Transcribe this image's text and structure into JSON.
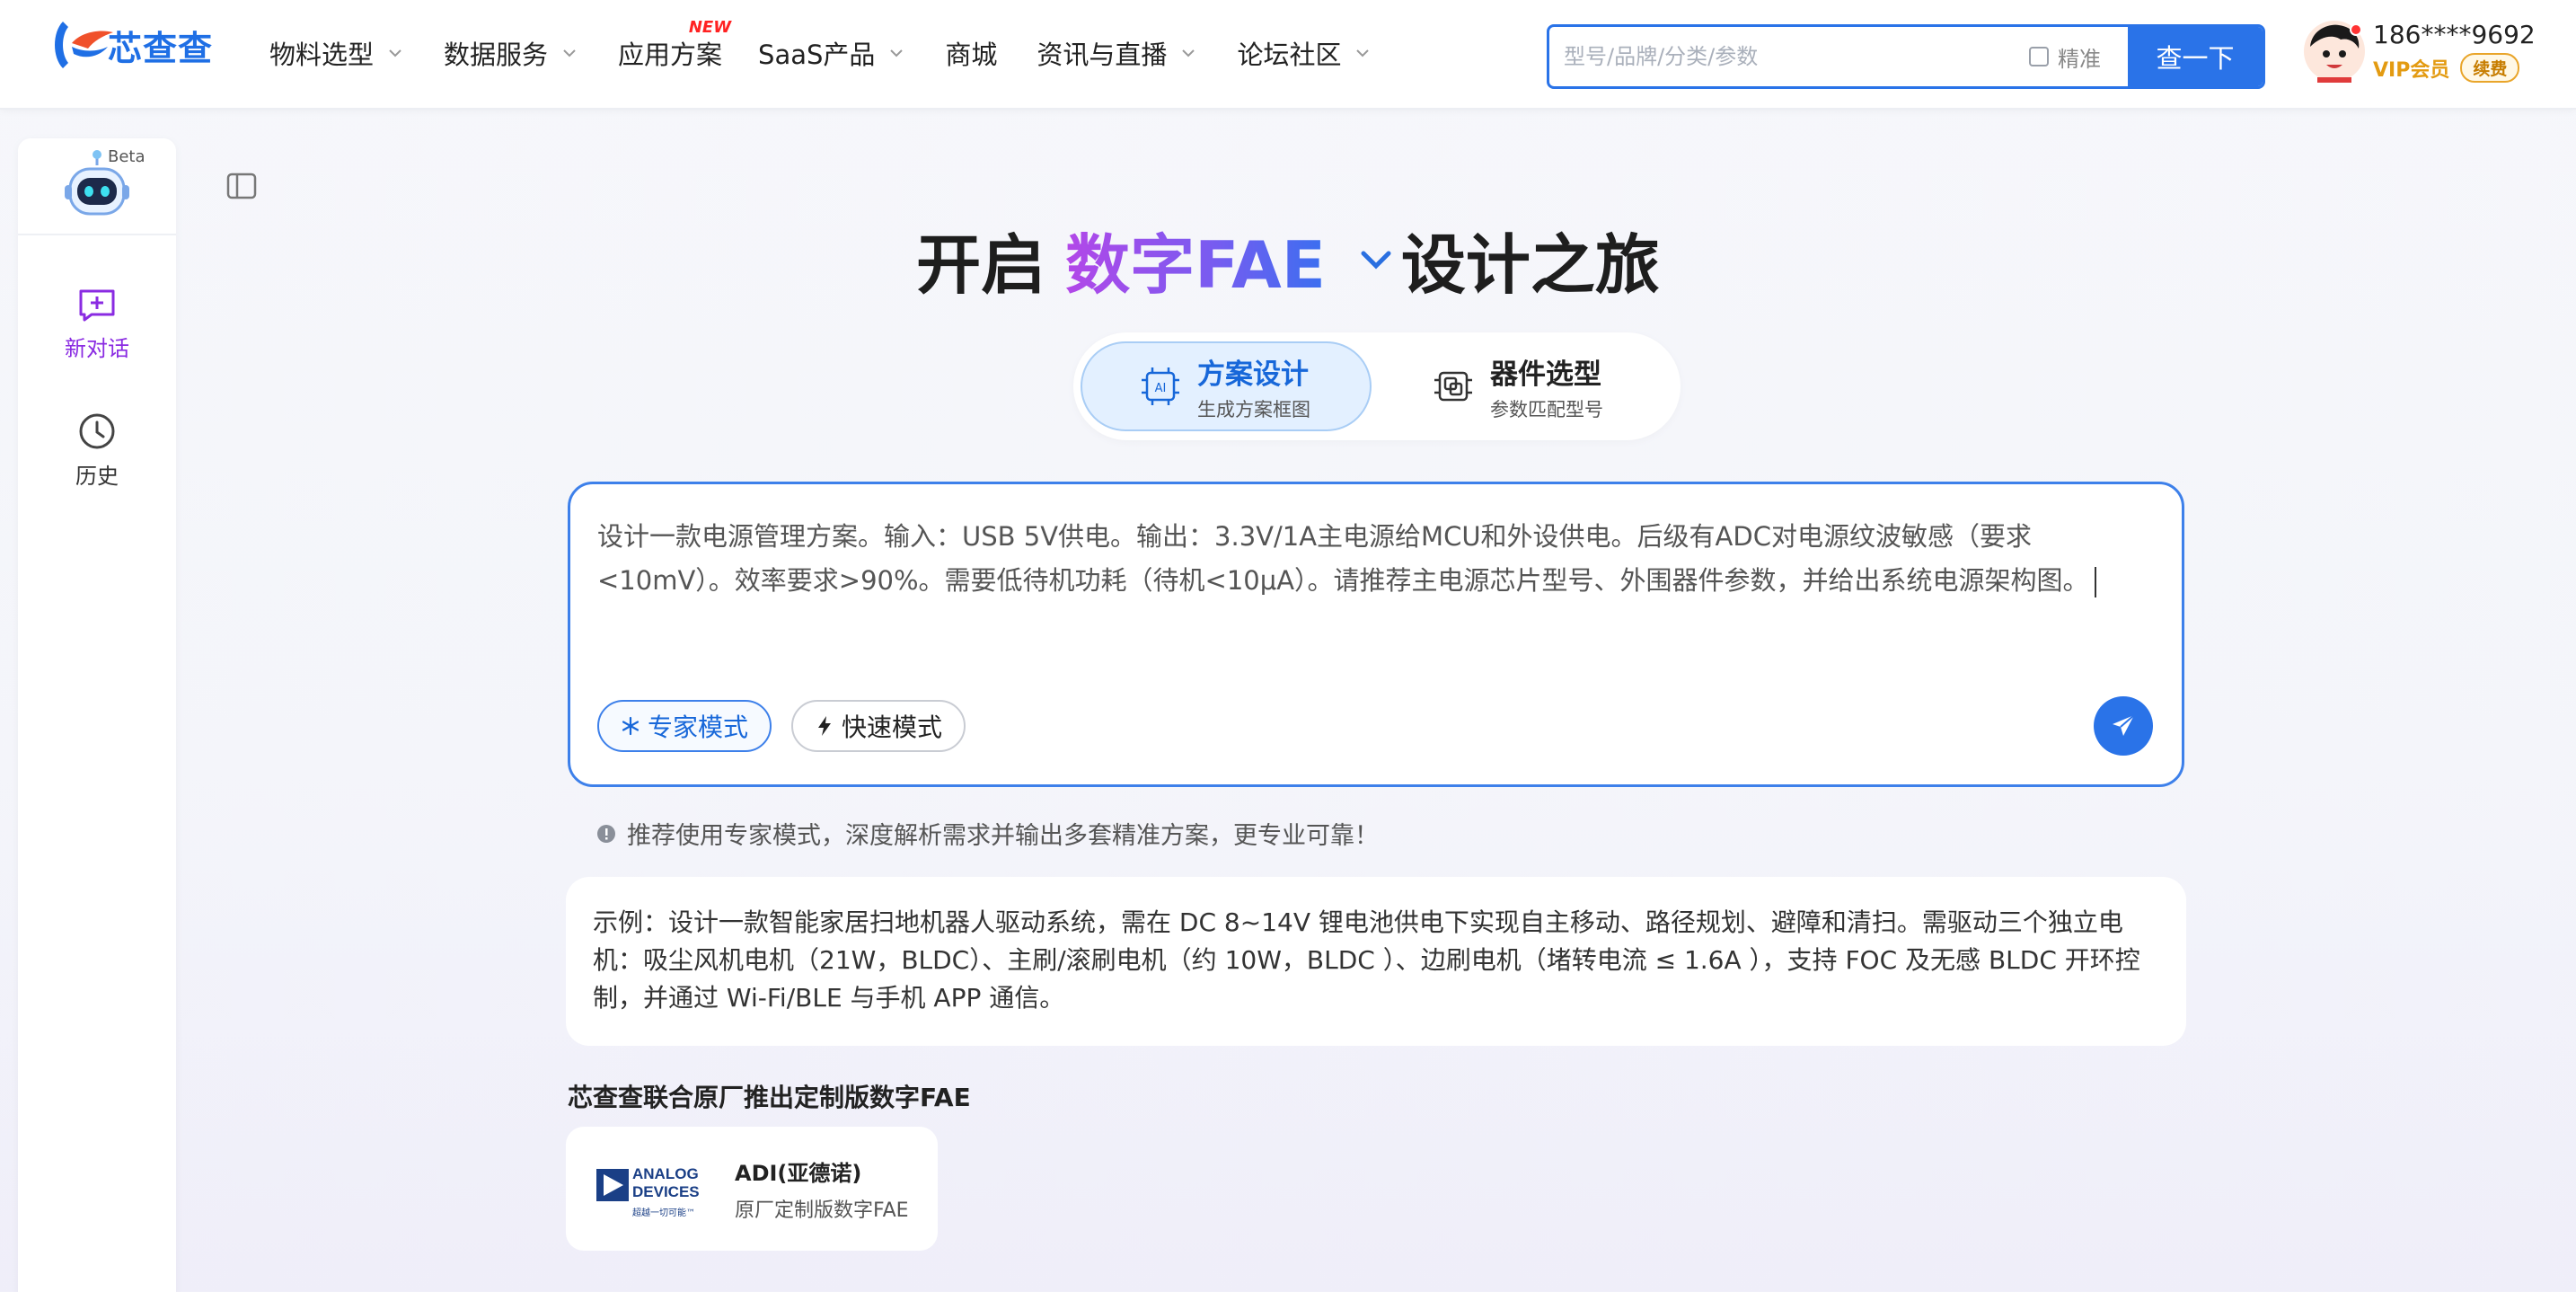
{
  "brand": {
    "name": "芯查查"
  },
  "nav": {
    "items": [
      {
        "label": "物料选型",
        "dropdown": true
      },
      {
        "label": "数据服务",
        "dropdown": true
      },
      {
        "label": "应用方案",
        "badge": "NEW"
      },
      {
        "label": "SaaS产品",
        "dropdown": true
      },
      {
        "label": "商城"
      },
      {
        "label": "资讯与直播",
        "dropdown": true
      },
      {
        "label": "论坛社区",
        "dropdown": true
      }
    ]
  },
  "search": {
    "placeholder": "型号/品牌/分类/参数",
    "precise_label": "精准",
    "button_label": "查一下"
  },
  "user": {
    "phone": "186****9692",
    "vip_label": "VIP会员",
    "renew_label": "续费"
  },
  "sidebar": {
    "beta": "Beta",
    "new_chat": "新对话",
    "history": "历史"
  },
  "hero": {
    "prefix": "开启",
    "highlight": "数字FAE",
    "suffix": "设计之旅"
  },
  "modes": {
    "scheme": {
      "title": "方案设计",
      "subtitle": "生成方案框图"
    },
    "component": {
      "title": "器件选型",
      "subtitle": "参数匹配型号"
    }
  },
  "prompt": {
    "text": "设计一款电源管理方案。输入：USB 5V供电。输出：3.3V/1A主电源给MCU和外设供电。后级有ADC对电源纹波敏感（要求<10mV）。效率要求>90%。需要低待机功耗（待机<10μA）。请推荐主电源芯片型号、外围器件参数，并给出系统电源架构图。",
    "expert_mode": "专家模式",
    "fast_mode": "快速模式"
  },
  "tip": "推荐使用专家模式，深度解析需求并输出多套精准方案，更专业可靠！",
  "example": "示例：设计一款智能家居扫地机器人驱动系统，需在 DC 8~14V 锂电池供电下实现自主移动、路径规划、避障和清扫。需驱动三个独立电机：吸尘风机电机（21W，BLDC）、主刷/滚刷电机（约 10W，BLDC ）、边刷电机（堵转电流 ≤ 1.6A ），支持 FOC 及无感 BLDC 开环控制，并通过 Wi-Fi/BLE 与手机 APP 通信。",
  "vendors_section": {
    "title": "芯查查联合原厂推出定制版数字FAE",
    "items": [
      {
        "logo_text": "ANALOG DEVICES",
        "logo_tagline": "超越一切可能™",
        "name": "ADI(亚德诺)",
        "desc": "原厂定制版数字FAE"
      }
    ]
  },
  "colors": {
    "accent": "#2a73e8",
    "vip": "#e39b12",
    "new_badge": "#ff2222",
    "highlight_gradient": [
      "#b347e8",
      "#3a6ff0"
    ]
  }
}
